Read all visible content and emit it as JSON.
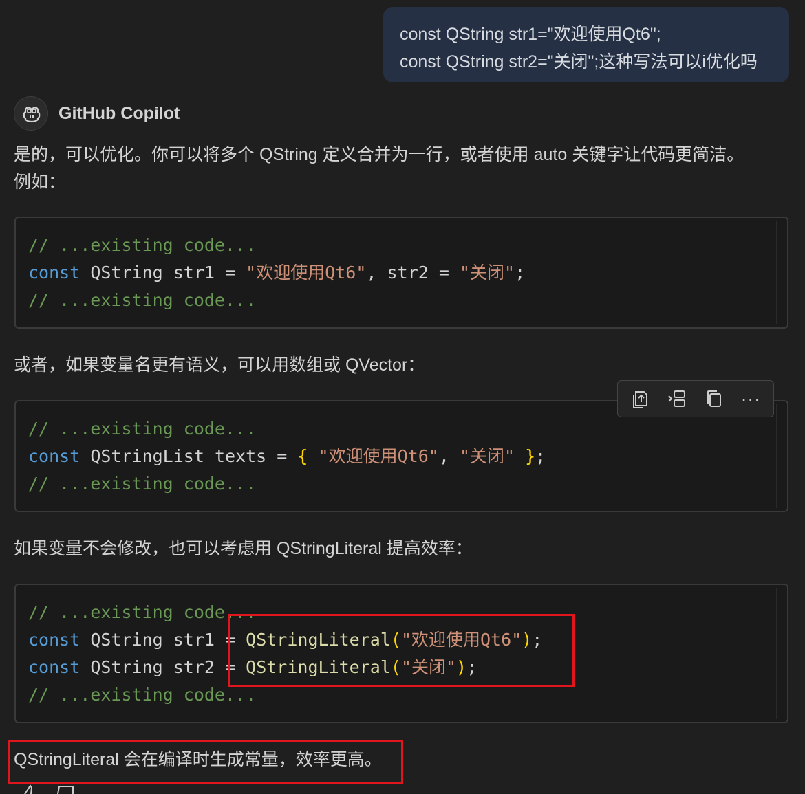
{
  "user_message": {
    "line1": "const QString str1=\"欢迎使用Qt6\";",
    "line2": "const QString str2=\"关闭\";这种写法可以i优化吗"
  },
  "assistant": {
    "name": "GitHub Copilot",
    "icon": "copilot-icon"
  },
  "paragraphs": {
    "p1_line1": "是的，可以优化。你可以将多个 QString 定义合并为一行，或者使用 auto 关键字让代码更简洁。",
    "p1_line2": "例如：",
    "p2": "或者，如果变量名更有语义，可以用数组或 QVector：",
    "p3": "如果变量不会修改，也可以考虑用 QStringLiteral 提高效率：",
    "p4": "QStringLiteral 会在编译时生成常量，效率更高。"
  },
  "code": {
    "comment": "// ...existing code...",
    "kw_const": "const",
    "block1": {
      "type": "QString",
      "v1": "str1",
      "eq": "=",
      "s1": "\"欢迎使用Qt6\"",
      "comma": ",",
      "v2": "str2",
      "s2": "\"关闭\"",
      "semi": ";"
    },
    "block2": {
      "type": "QStringList",
      "v1": "texts",
      "eq": "=",
      "open": "{",
      "s1": "\"欢迎使用Qt6\"",
      "comma": ",",
      "s2": "\"关闭\"",
      "close": "}",
      "semi": ";"
    },
    "block3": {
      "type": "QString",
      "v1": "str1",
      "v2": "str2",
      "eq": "=",
      "fn": "QStringLiteral",
      "lp": "(",
      "rp": ")",
      "s1": "\"欢迎使用Qt6\"",
      "s2": "\"关闭\"",
      "semi": ";"
    }
  },
  "toolbar": {
    "icons": [
      "insert-at-cursor-icon",
      "insert-into-new-file-icon",
      "copy-icon",
      "more-actions-icon"
    ],
    "more_label": "···"
  },
  "colors": {
    "background": "#1f1f1f",
    "user_bubble": "#253044",
    "comment": "#6a9955",
    "keyword": "#569cd6",
    "string": "#ce9178",
    "function": "#dcdcaa",
    "bracket": "#ffd700",
    "highlight_box": "#e0151e"
  }
}
